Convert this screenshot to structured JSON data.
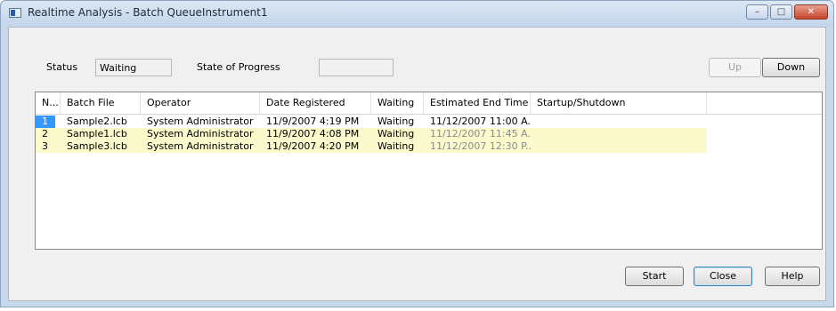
{
  "window": {
    "title": "Realtime Analysis - Batch QueueInstrument1",
    "minimize_glyph": "–",
    "maximize_glyph": "□",
    "close_glyph": "✕"
  },
  "status": {
    "label": "Status",
    "value": "Waiting",
    "progress_label": "State of Progress",
    "progress_value": ""
  },
  "buttons": {
    "up": "Up",
    "down": "Down",
    "start": "Start",
    "close": "Close",
    "help": "Help"
  },
  "table": {
    "columns": [
      "N...",
      "Batch File",
      "Operator",
      "Date Registered",
      "Waiting",
      "Estimated End Time",
      "Startup/Shutdown"
    ],
    "rows": [
      [
        "1",
        "Sample2.lcb",
        "System Administrator",
        "11/9/2007 4:19 PM",
        "Waiting",
        "11/12/2007 11:00 A...",
        ""
      ],
      [
        "2",
        "Sample1.lcb",
        "System Administrator",
        "11/9/2007 4:08 PM",
        "Waiting",
        "11/12/2007 11:45 A...",
        ""
      ],
      [
        "3",
        "Sample3.lcb",
        "System Administrator",
        "11/9/2007 4:20 PM",
        "Waiting",
        "11/12/2007 12:30 P...",
        ""
      ]
    ]
  },
  "colors": {
    "selection": "#3399ff",
    "row_highlight": "#fafacd",
    "dim_text": "#8a8a8a"
  }
}
